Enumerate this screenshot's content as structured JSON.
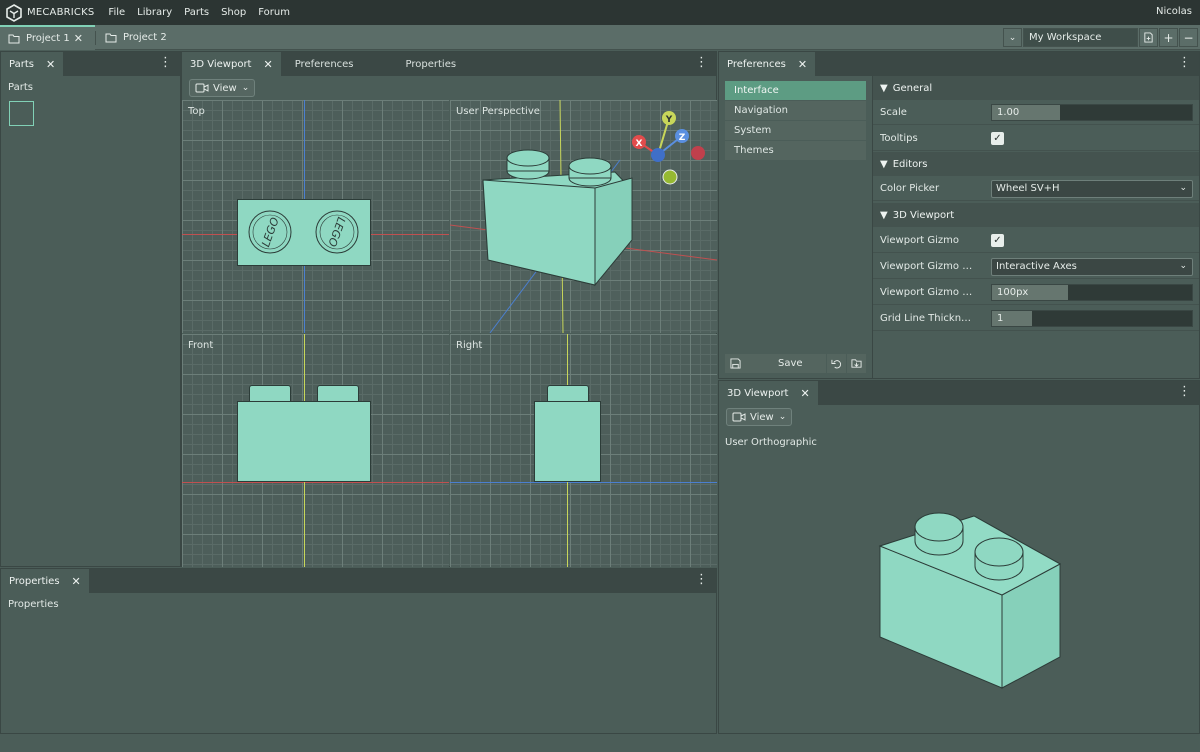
{
  "brand": "MECABRICKS",
  "menu": [
    "File",
    "Library",
    "Parts",
    "Shop",
    "Forum"
  ],
  "user": "Nicolas",
  "projects": [
    {
      "label": "Project 1"
    },
    {
      "label": "Project 2"
    }
  ],
  "workspace": {
    "value": "My Workspace"
  },
  "parts_panel": {
    "tab": "Parts",
    "heading": "Parts"
  },
  "properties_panel": {
    "tab": "Properties",
    "heading": "Properties"
  },
  "center_panel": {
    "tabs": [
      "3D Viewport",
      "Preferences",
      "Properties"
    ],
    "view_button": "View",
    "viewports": {
      "top": "Top",
      "persp": "User Perspective",
      "front": "Front",
      "right": "Right"
    },
    "gizmo": {
      "x": "X",
      "y": "Y",
      "z": "Z"
    },
    "brick_text": {
      "stud1": "LEGO",
      "stud2": "LEGO"
    }
  },
  "prefs": {
    "tab": "Preferences",
    "nav": [
      "Interface",
      "Navigation",
      "System",
      "Themes"
    ],
    "save_label": "Save",
    "sections": {
      "general": "General",
      "editors": "Editors",
      "viewport": "3D Viewport"
    },
    "rows": {
      "scale": {
        "label": "Scale",
        "value": "1.00"
      },
      "tooltips": {
        "label": "Tooltips",
        "checked": true
      },
      "color_picker": {
        "label": "Color Picker",
        "value": "Wheel SV+H"
      },
      "gizmo": {
        "label": "Viewport Gizmo",
        "checked": true
      },
      "gizmo_value": {
        "label": "Viewport Gizmo Va...",
        "value": "Interactive Axes"
      },
      "gizmo_size": {
        "label": "Viewport Gizmo Size",
        "value": "100px"
      },
      "grid_line": {
        "label": "Grid Line Thickness",
        "value": "1"
      }
    }
  },
  "ortho_panel": {
    "tab": "3D Viewport",
    "view_button": "View",
    "label": "User Orthographic"
  },
  "colors": {
    "accent": "#81d1b6",
    "brick": "#8fd8c2",
    "panel": "#4b5d58"
  }
}
